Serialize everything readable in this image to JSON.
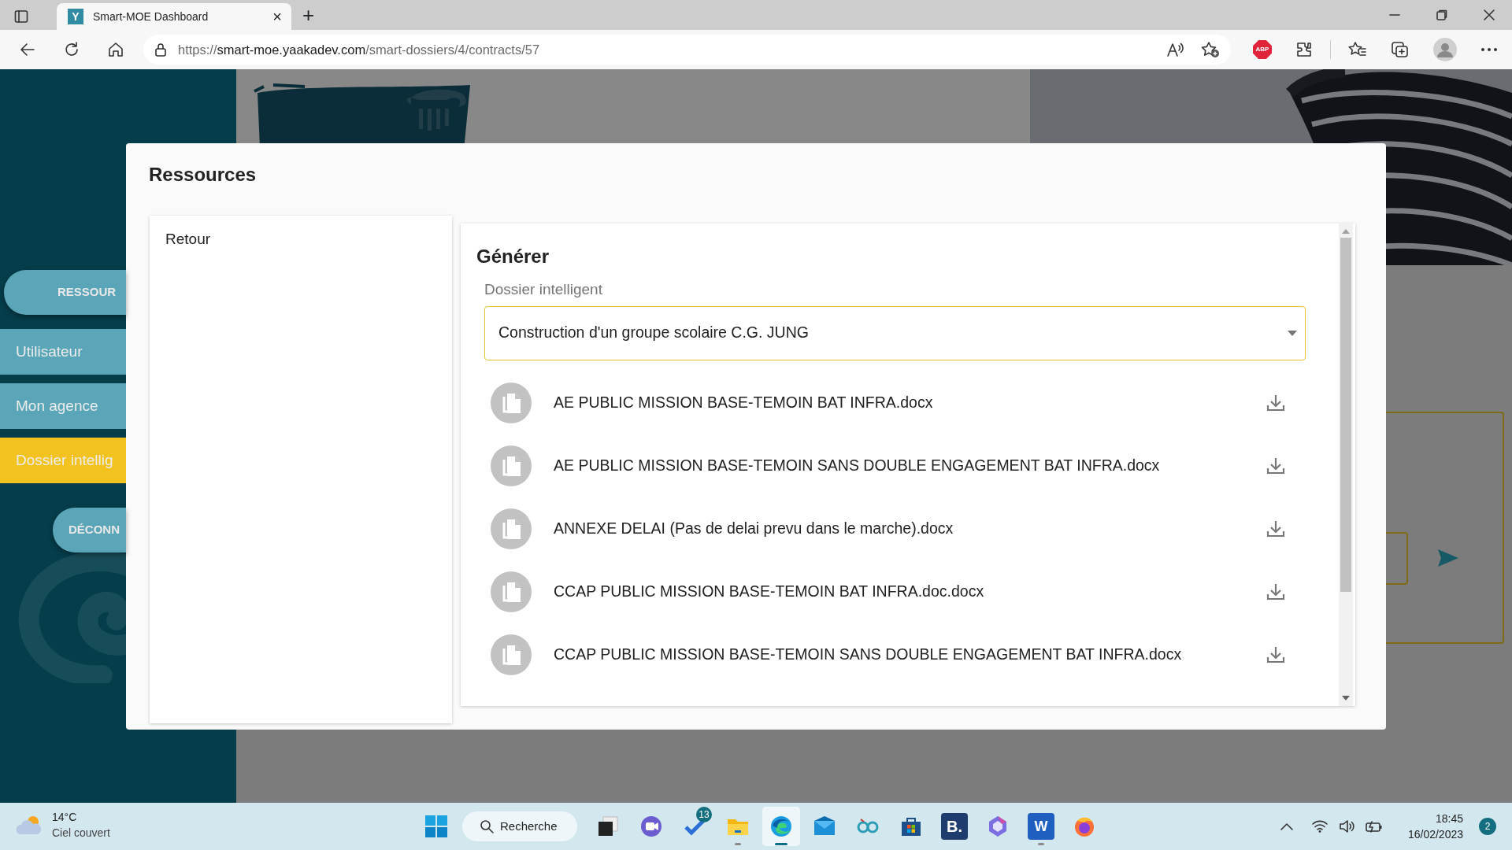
{
  "browser": {
    "tab": {
      "favicon": "Y",
      "title": "Smart-MOE Dashboard",
      "close": "×",
      "selected": true
    },
    "new_tab": "+",
    "url": {
      "scheme": "https://",
      "host": "smart-moe.yaakadev.com",
      "path": "/smart-dossiers/4/contracts/57"
    },
    "extension_badge": "ABP"
  },
  "sidebar": {
    "items": [
      {
        "kind": "pill",
        "label": "RESSOUR",
        "selected": false
      },
      {
        "kind": "item",
        "label": "Utilisateur",
        "selected": false
      },
      {
        "kind": "item",
        "label": "Mon agence",
        "selected": false
      },
      {
        "kind": "item",
        "label": "Dossier intellig",
        "selected": true
      },
      {
        "kind": "pill",
        "label": "DÉCONN",
        "selected": false
      }
    ]
  },
  "modal": {
    "title": "Ressources",
    "menu": [
      {
        "label": "Retour"
      }
    ],
    "panel": {
      "title": "Générer",
      "field_label": "Dossier intelligent",
      "select_value": "Construction d'un groupe scolaire C.G. JUNG",
      "files": [
        {
          "name": "AE PUBLIC MISSION BASE-TEMOIN BAT INFRA.docx"
        },
        {
          "name": "AE PUBLIC MISSION BASE-TEMOIN SANS DOUBLE ENGAGEMENT BAT INFRA.docx"
        },
        {
          "name": "ANNEXE DELAI (Pas de delai prevu dans le marche).docx"
        },
        {
          "name": "CCAP PUBLIC MISSION BASE-TEMOIN BAT INFRA.doc.docx"
        },
        {
          "name": "CCAP PUBLIC MISSION BASE-TEMOIN SANS DOUBLE ENGAGEMENT BAT INFRA.docx"
        }
      ]
    }
  },
  "taskbar": {
    "weather": {
      "temperature": "14°C",
      "condition": "Ciel couvert"
    },
    "search": "Recherche",
    "apps": [
      {
        "kind": "taskview",
        "running": false,
        "selected": false
      },
      {
        "kind": "chat",
        "running": false,
        "selected": false
      },
      {
        "kind": "todo",
        "badge": "13",
        "running": false,
        "selected": false
      },
      {
        "kind": "explorer",
        "running": true,
        "selected": false
      },
      {
        "kind": "edge",
        "running": true,
        "selected": true
      },
      {
        "kind": "mail",
        "running": false,
        "selected": false
      },
      {
        "kind": "loop",
        "running": false,
        "selected": false
      },
      {
        "kind": "store",
        "running": false,
        "selected": false
      },
      {
        "kind": "booking",
        "label": "B.",
        "running": false,
        "selected": false
      },
      {
        "kind": "office",
        "running": false,
        "selected": false
      },
      {
        "kind": "word",
        "label": "W",
        "running": true,
        "selected": false
      },
      {
        "kind": "firefox",
        "running": false,
        "selected": false
      }
    ],
    "time": "18:45",
    "date": "16/02/2023",
    "notifications": "2"
  }
}
